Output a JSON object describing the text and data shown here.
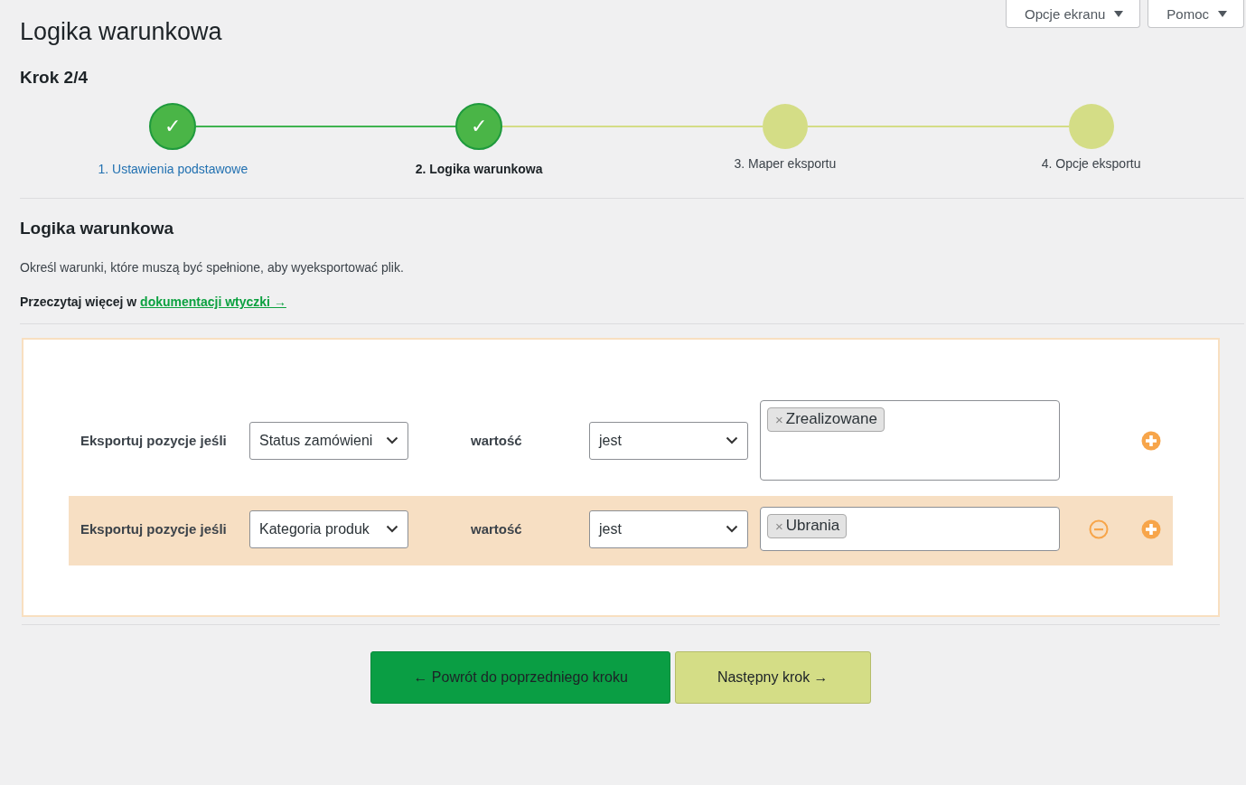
{
  "page_title": "Logika warunkowa",
  "header_buttons": [
    {
      "label": "Opcje ekranu"
    },
    {
      "label": "Pomoc"
    }
  ],
  "step_counter": "Krok 2/4",
  "steps": [
    {
      "label": "1. Ustawienia podstawowe",
      "done": true,
      "selected": false,
      "mark": "✓"
    },
    {
      "label": "2. Logika warunkowa",
      "done": true,
      "selected": true,
      "mark": "✓"
    },
    {
      "label": "3. Maper eksportu",
      "done": false,
      "selected": false
    },
    {
      "label": "4. Opcje eksportu",
      "done": false,
      "selected": false
    }
  ],
  "section": {
    "title": "Logika warunkowa",
    "description": "Określ warunki, które muszą być spełnione, aby wyeksportować plik.",
    "read_more": "Przeczytaj więcej w",
    "link": "dokumentacji wtyczki →"
  },
  "rules": [
    {
      "label": "Eksportuj pozycje jeśli",
      "field": "Status zamówieni",
      "value_label": "wartość",
      "operator": "jest",
      "tags": [
        {
          "label": "Zrealizowane",
          "remove": "×"
        }
      ],
      "highlighted": false,
      "removable": false,
      "multiline": true
    },
    {
      "label": "Eksportuj pozycje jeśli",
      "field": "Kategoria produk",
      "value_label": "wartość",
      "operator": "jest",
      "tags": [
        {
          "label": "Ubrania",
          "remove": "×"
        }
      ],
      "highlighted": true,
      "removable": true,
      "multiline": false
    }
  ],
  "buttons": [
    {
      "label": "← Powrót do poprzedniego kroku",
      "kind": "back"
    },
    {
      "label": "Następny krok →",
      "kind": "next"
    }
  ]
}
